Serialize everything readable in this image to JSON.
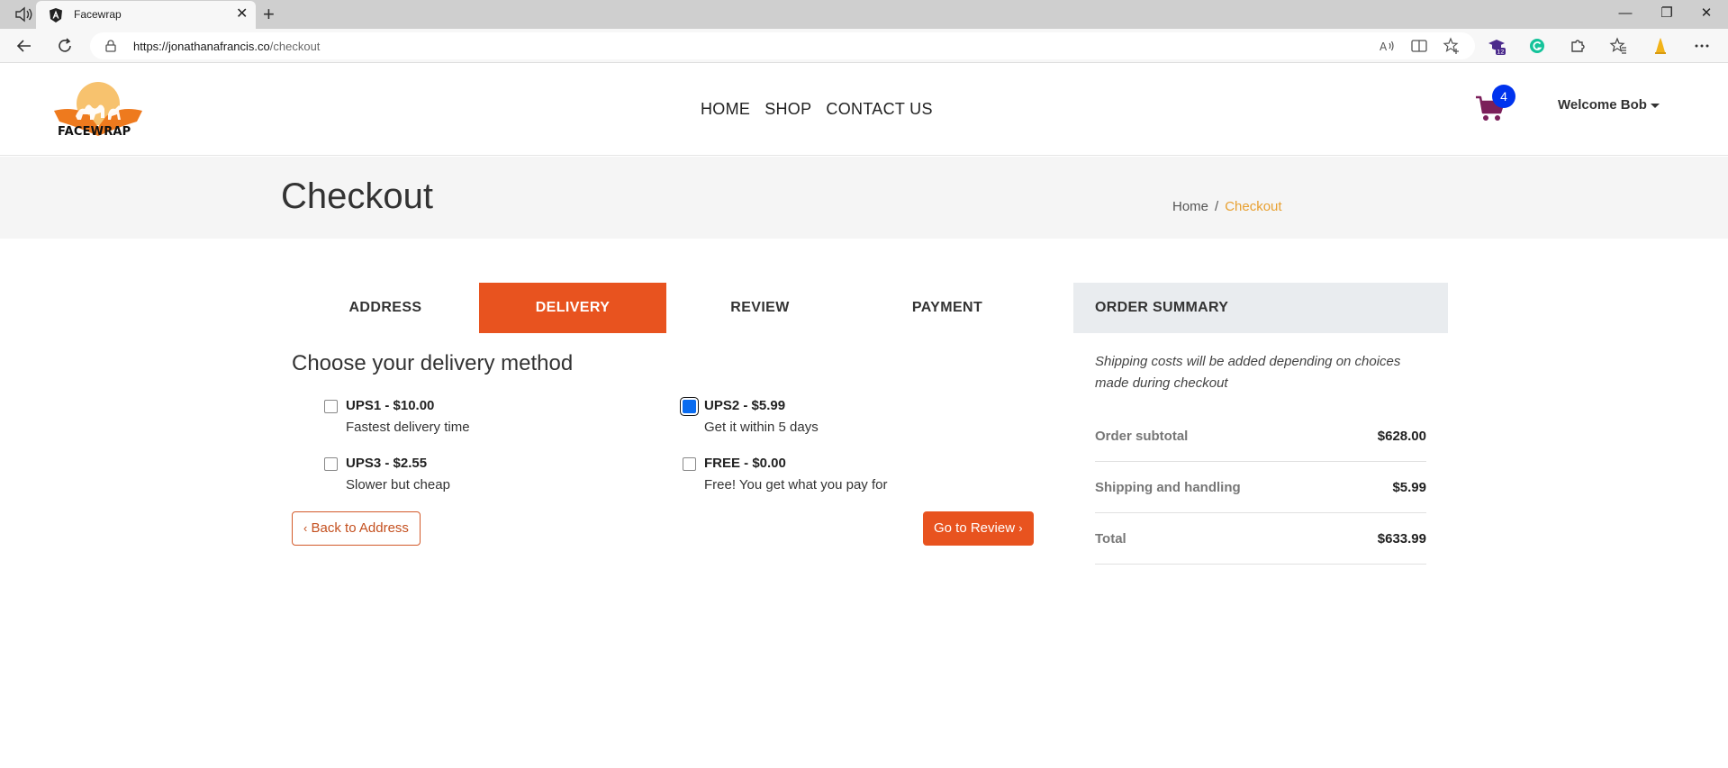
{
  "browser": {
    "tab_title": "Facewrap",
    "url_host": "https://jonathanafrancis.co",
    "url_path": "/checkout",
    "extension_badge": "12"
  },
  "header": {
    "logo_text": "FACEWRAP",
    "nav": [
      "HOME",
      "SHOP",
      "CONTACT US"
    ],
    "cart_count": "4",
    "welcome": "Welcome Bob"
  },
  "page": {
    "title": "Checkout",
    "breadcrumb": {
      "home": "Home",
      "separator": "/",
      "current": "Checkout"
    }
  },
  "steps": [
    {
      "label": "ADDRESS",
      "active": false
    },
    {
      "label": "DELIVERY",
      "active": true
    },
    {
      "label": "REVIEW",
      "active": false
    },
    {
      "label": "PAYMENT",
      "active": false
    }
  ],
  "delivery": {
    "heading": "Choose your delivery method",
    "options": [
      {
        "label": "UPS1 - $10.00",
        "desc": "Fastest delivery time",
        "checked": false
      },
      {
        "label": "UPS2 - $5.99",
        "desc": "Get it within 5 days",
        "checked": true
      },
      {
        "label": "UPS3 - $2.55",
        "desc": "Slower but cheap",
        "checked": false
      },
      {
        "label": "FREE - $0.00",
        "desc": "Free! You get what you pay for",
        "checked": false
      }
    ],
    "back_label": "Back to Address",
    "next_label": "Go to Review"
  },
  "summary": {
    "heading": "ORDER SUMMARY",
    "note": "Shipping costs will be added depending on choices made during checkout",
    "rows": [
      {
        "label": "Order subtotal",
        "value": "$628.00"
      },
      {
        "label": "Shipping and handling",
        "value": "$5.99"
      },
      {
        "label": "Total",
        "value": "$633.99"
      }
    ]
  },
  "colors": {
    "accent": "#e8531f",
    "breadcrumb_active": "#e8a030",
    "cart": "#7b1f5a",
    "badge": "#0033ee",
    "checked": "#0a6cf0"
  }
}
